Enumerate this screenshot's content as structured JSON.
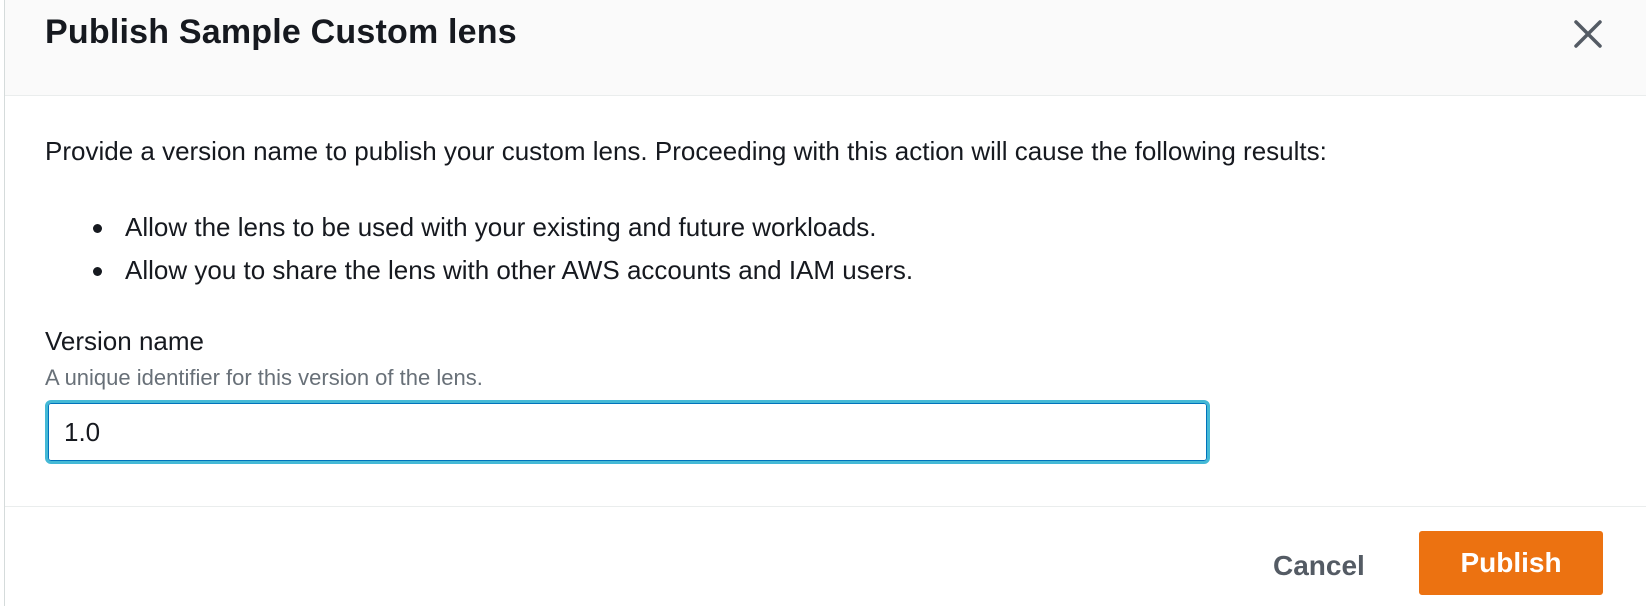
{
  "modal": {
    "title": "Publish Sample Custom lens",
    "close_icon": "close-icon"
  },
  "body": {
    "intro": "Provide a version name to publish your custom lens. Proceeding with this action will cause the following results:",
    "results": [
      "Allow the lens to be used with your existing and future workloads.",
      "Allow you to share the lens with other AWS accounts and IAM users."
    ]
  },
  "version_field": {
    "label": "Version name",
    "description": "A unique identifier for this version of the lens.",
    "value": "1.0",
    "focus_color": "#44b9d6"
  },
  "footer": {
    "cancel_label": "Cancel",
    "publish_label": "Publish",
    "primary_color": "#ec7211"
  }
}
